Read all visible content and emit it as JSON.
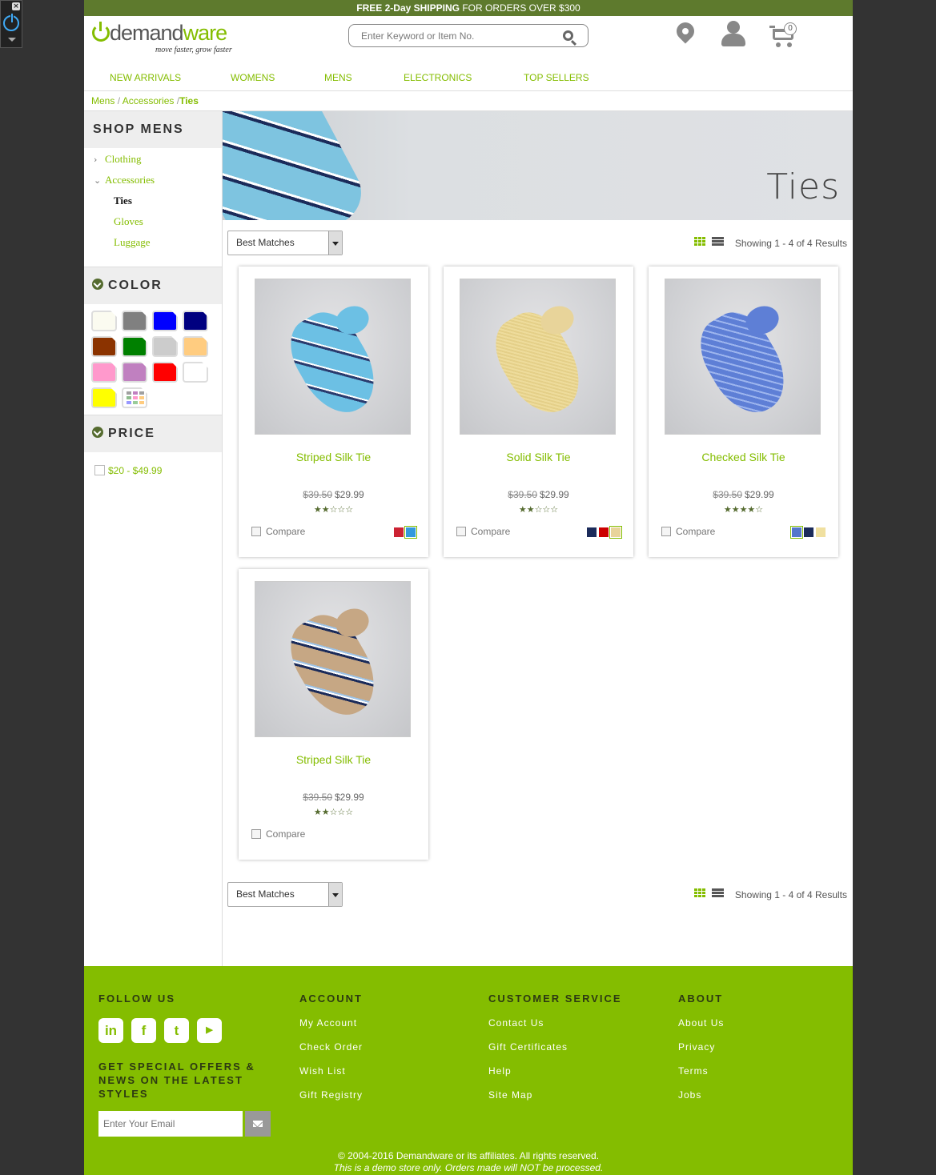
{
  "promo": {
    "strong1": "FREE 2-Day",
    "strong2": "SHIPPING",
    "rest": " FOR ORDERS OVER $300"
  },
  "brand": {
    "name_part1": "demand",
    "name_part2": "ware",
    "tagline": "move faster, grow faster",
    "accent": "#84bd00"
  },
  "search": {
    "placeholder": "Enter Keyword or Item No.",
    "value": ""
  },
  "header_icons": [
    "map-pin-icon",
    "user-icon",
    "cart-icon"
  ],
  "cart": {
    "count": "0"
  },
  "nav": {
    "items": [
      "NEW ARRIVALS",
      "WOMENS",
      "MENS",
      "ELECTRONICS",
      "TOP SELLERS"
    ]
  },
  "breadcrumb": {
    "items": [
      "Mens",
      "Accessories",
      "Ties"
    ],
    "separator": "/"
  },
  "sidebar": {
    "title": "SHOP MENS",
    "categories": [
      {
        "label": "Clothing",
        "expanded": false
      },
      {
        "label": "Accessories",
        "expanded": true,
        "children": [
          "Ties",
          "Gloves",
          "Luggage"
        ],
        "selected": "Ties"
      }
    ],
    "color_title": "COLOR",
    "colors": [
      "#fbfbf0",
      "#808080",
      "#0000ff",
      "#000080",
      "#8b3300",
      "#008000",
      "#cccccc",
      "#ffcc80",
      "#ff99cc",
      "#c080c0",
      "#ff0000",
      "#ffffff",
      "#ffff00",
      "multi"
    ],
    "price_title": "PRICE",
    "price_options": [
      "$20 - $49.99"
    ]
  },
  "banner": {
    "title": "Ties"
  },
  "toolbar": {
    "sort_value": "Best Matches",
    "results": "Showing 1 - 4 of 4 Results"
  },
  "products": [
    {
      "name": "Striped Silk Tie",
      "old_price": "$39.50",
      "price": "$29.99",
      "rating": 2.5,
      "stars": "★★☆☆☆",
      "compare": "Compare",
      "swatches": [
        "#cc2233",
        "#3399dd"
      ],
      "selected_swatch": 1
    },
    {
      "name": "Solid Silk Tie",
      "old_price": "$39.50",
      "price": "$29.99",
      "rating": 2.5,
      "stars": "★★☆☆☆",
      "compare": "Compare",
      "swatches": [
        "#1b2b5a",
        "#cc0000",
        "#e8d49a"
      ],
      "selected_swatch": 2
    },
    {
      "name": "Checked Silk Tie",
      "old_price": "$39.50",
      "price": "$29.99",
      "rating": 4.5,
      "stars": "★★★★☆",
      "compare": "Compare",
      "swatches": [
        "#5577cc",
        "#1b2b5a",
        "#f0e0a0"
      ],
      "selected_swatch": 0
    },
    {
      "name": "Striped Silk Tie",
      "old_price": "$39.50",
      "price": "$29.99",
      "rating": 2.5,
      "stars": "★★☆☆☆",
      "compare": "Compare",
      "swatches": [],
      "selected_swatch": -1
    }
  ],
  "footer": {
    "follow_title": "FOLLOW US",
    "social": [
      "linkedin-icon",
      "facebook-icon",
      "twitter-icon",
      "youtube-icon"
    ],
    "offers_text": "GET SPECIAL OFFERS & NEWS ON THE LATEST STYLES",
    "email_placeholder": "Enter Your Email",
    "account": {
      "title": "ACCOUNT",
      "links": [
        "My Account",
        "Check Order",
        "Wish List",
        "Gift Registry"
      ]
    },
    "service": {
      "title": "CUSTOMER SERVICE",
      "links": [
        "Contact Us",
        "Gift Certificates",
        "Help",
        "Site Map"
      ]
    },
    "about": {
      "title": "ABOUT",
      "links": [
        "About Us",
        "Privacy",
        "Terms",
        "Jobs"
      ]
    },
    "copyright": "© 2004-2016 Demandware or its affiliates. All rights reserved.",
    "demo_note": "This is a demo store only. Orders made will NOT be processed."
  }
}
